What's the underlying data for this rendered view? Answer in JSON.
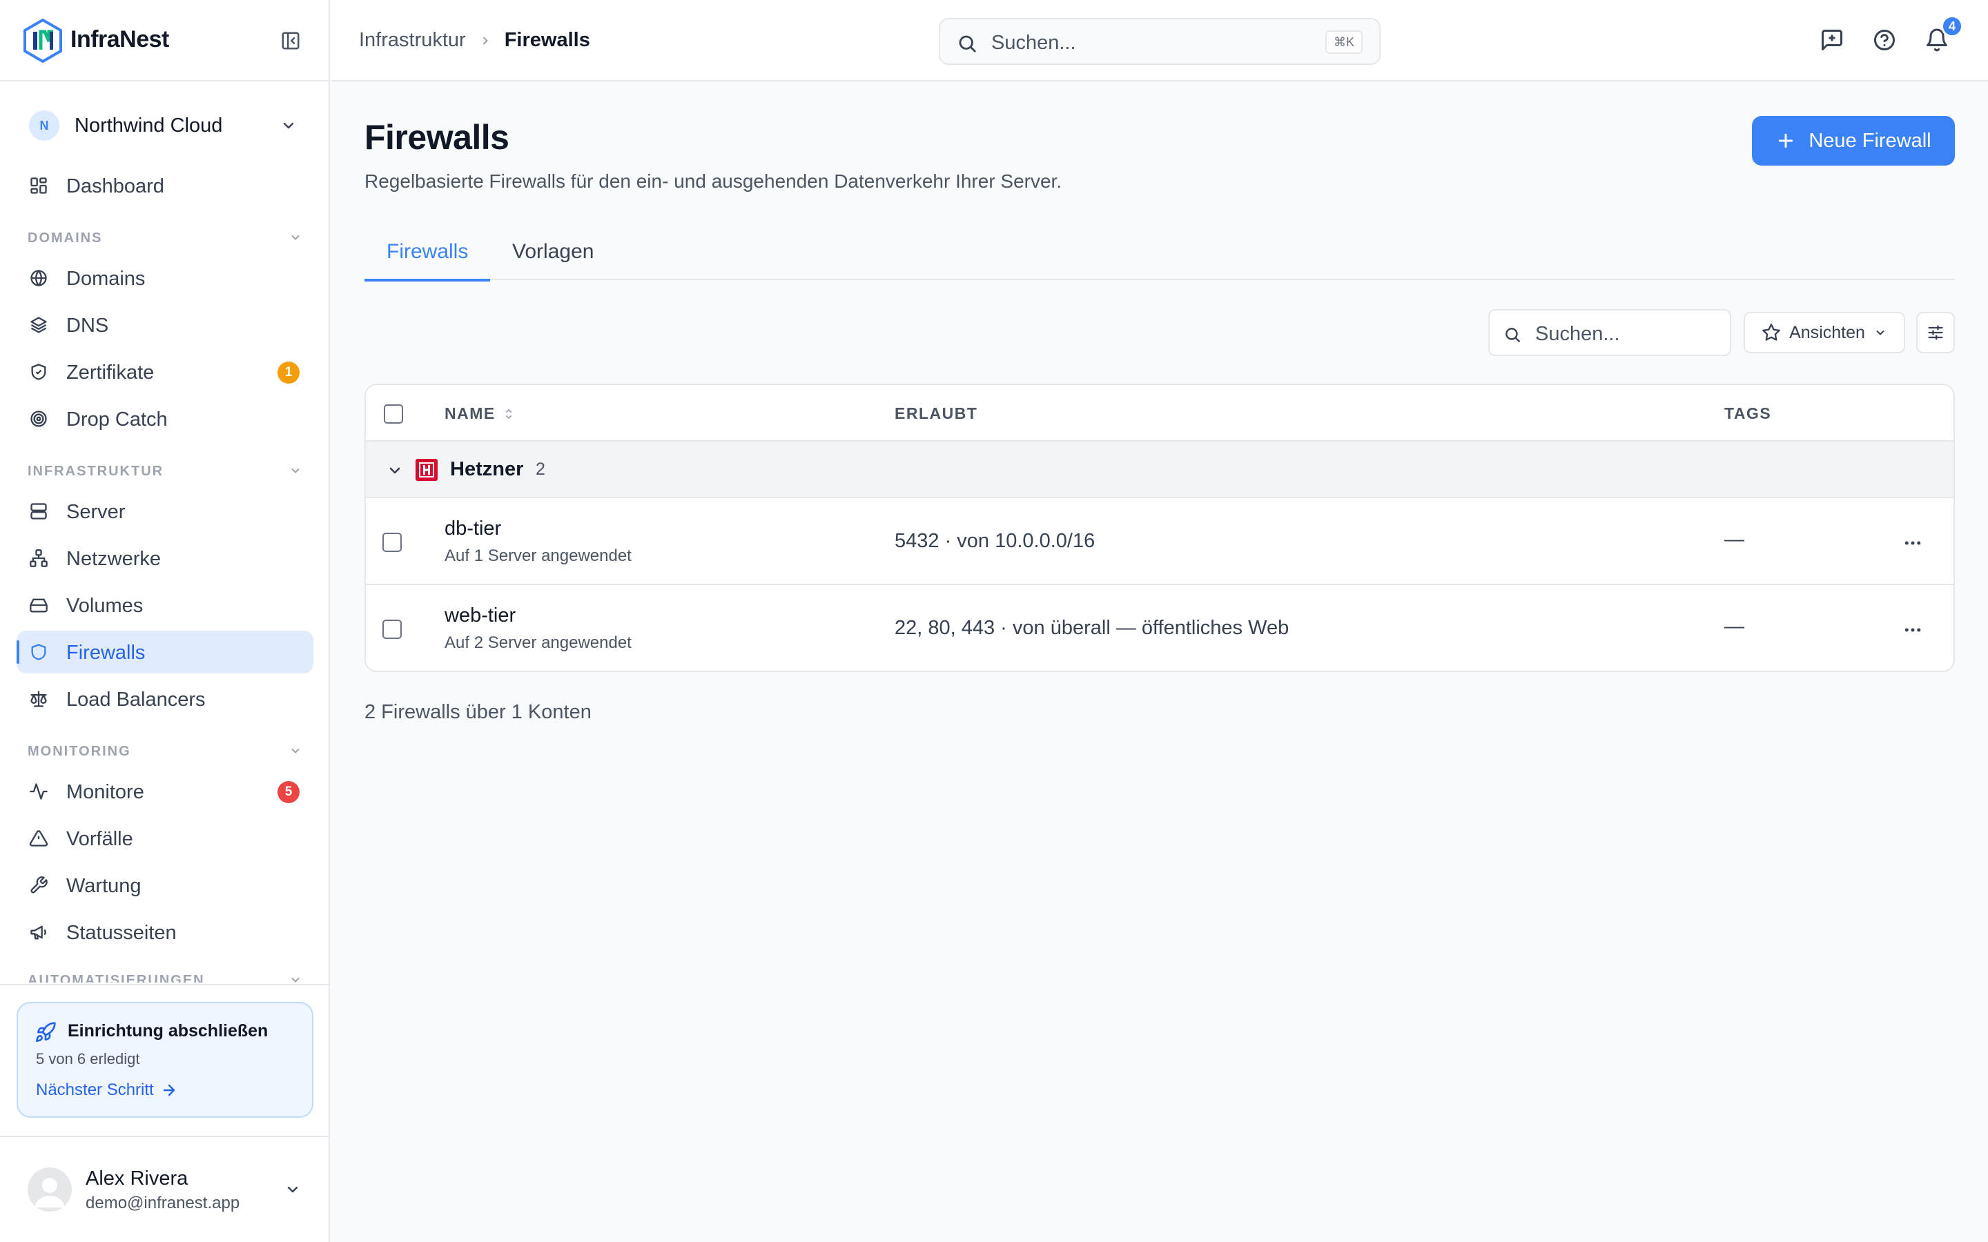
{
  "brand": {
    "name": "InfraNest"
  },
  "sidebar": {
    "org": {
      "initial": "N",
      "name": "Northwind Cloud"
    },
    "dashboard": "Dashboard",
    "sections": [
      {
        "label": "DOMAINS",
        "items": [
          {
            "label": "Domains",
            "icon": "globe-icon"
          },
          {
            "label": "DNS",
            "icon": "layers-icon"
          },
          {
            "label": "Zertifikate",
            "icon": "shield-check-icon",
            "badge": "1"
          },
          {
            "label": "Drop Catch",
            "icon": "target-icon"
          }
        ]
      },
      {
        "label": "INFRASTRUKTUR",
        "items": [
          {
            "label": "Server",
            "icon": "server-icon"
          },
          {
            "label": "Netzwerke",
            "icon": "network-icon"
          },
          {
            "label": "Volumes",
            "icon": "hard-drive-icon"
          },
          {
            "label": "Firewalls",
            "icon": "shield-icon",
            "active": true
          },
          {
            "label": "Load Balancers",
            "icon": "scale-icon"
          }
        ]
      },
      {
        "label": "MONITORING",
        "items": [
          {
            "label": "Monitore",
            "icon": "activity-icon",
            "badge": "5"
          },
          {
            "label": "Vorfälle",
            "icon": "alert-triangle-icon"
          },
          {
            "label": "Wartung",
            "icon": "wrench-icon"
          },
          {
            "label": "Statusseiten",
            "icon": "megaphone-icon"
          }
        ]
      },
      {
        "label": "AUTOMATISIERUNGEN"
      }
    ],
    "onboarding": {
      "title": "Einrichtung abschließen",
      "progress": "5 von 6 erledigt",
      "link": "Nächster Schritt"
    },
    "user": {
      "name": "Alex Rivera",
      "email": "demo@infranest.app"
    }
  },
  "topbar": {
    "breadcrumb": {
      "parent": "Infrastruktur",
      "current": "Firewalls"
    },
    "search_placeholder": "Suchen...",
    "shortcut": "⌘K",
    "notifications_count": "4"
  },
  "page": {
    "title": "Firewalls",
    "subtitle": "Regelbasierte Firewalls für den ein- und ausgehenden Datenverkehr Ihrer Server.",
    "primary_button": "Neue Firewall",
    "tabs": [
      {
        "label": "Firewalls",
        "active": true
      },
      {
        "label": "Vorlagen"
      }
    ],
    "table_search_placeholder": "Suchen...",
    "views_label": "Ansichten",
    "columns": {
      "name": "NAME",
      "allowed": "ERLAUBT",
      "tags": "TAGS"
    },
    "group": {
      "name": "Hetzner",
      "count": "2"
    },
    "rows": [
      {
        "name": "db-tier",
        "applied": "Auf 1 Server angewendet",
        "allowed": "5432 · von 10.0.0.0/16",
        "tags": "—"
      },
      {
        "name": "web-tier",
        "applied": "Auf 2 Server angewendet",
        "allowed": "22, 80, 443 · von überall — öffentliches Web",
        "tags": "—"
      }
    ],
    "footer": "2 Firewalls über 1 Konten"
  },
  "colors": {
    "accent": "#3b82f6",
    "active_bg": "#e0ecfd",
    "hetzner": "#d50c2d",
    "warning": "#f59e0b",
    "danger": "#ef4444"
  }
}
